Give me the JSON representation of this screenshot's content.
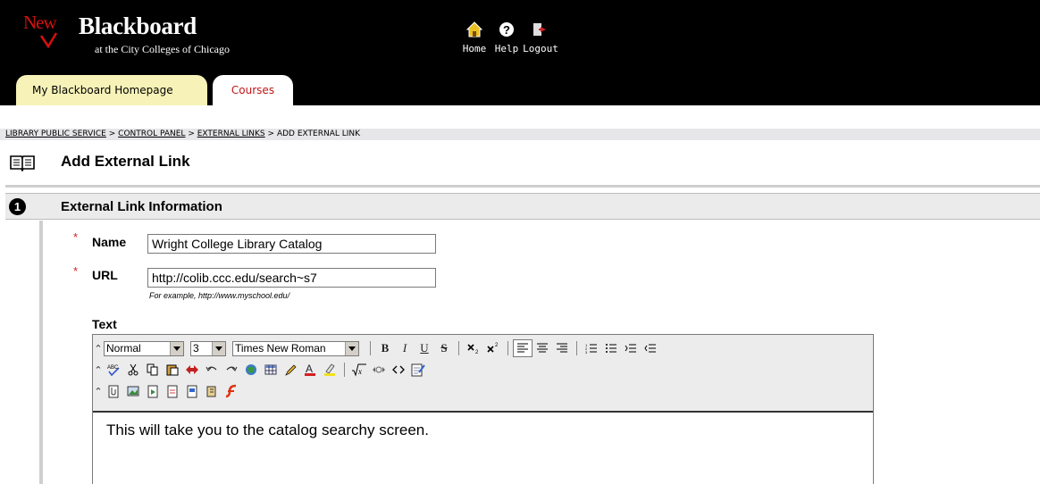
{
  "header": {
    "logo_new": "New",
    "logo_title": "Blackboard",
    "logo_subtitle": "at the City Colleges of Chicago",
    "nav": {
      "home": "Home",
      "help": "Help",
      "logout": "Logout"
    },
    "tabs": {
      "home": "My Blackboard Homepage",
      "courses": "Courses"
    }
  },
  "breadcrumb": {
    "items": [
      "LIBRARY PUBLIC SERVICE",
      "CONTROL PANEL",
      "EXTERNAL LINKS"
    ],
    "current": "ADD EXTERNAL LINK",
    "separator": ">"
  },
  "page": {
    "title": "Add External Link"
  },
  "section": {
    "number": "1",
    "title": "External Link Information",
    "required_mark": "*",
    "name_label": "Name",
    "name_value": "Wright College Library Catalog",
    "url_label": "URL",
    "url_value": "http://colib.ccc.edu/search~s7",
    "url_hint": "For example, http://www.myschool.edu/",
    "text_label": "Text"
  },
  "editor": {
    "format": "Normal",
    "size": "3",
    "font": "Times New Roman",
    "bold": "B",
    "italic": "I",
    "underline": "U",
    "strike": "S",
    "content": "This will take you to the catalog searchy screen."
  },
  "colors": {
    "accent_red": "#d41010",
    "tab_yellow": "#f7f3b8",
    "section_gray": "#ebebeb"
  }
}
